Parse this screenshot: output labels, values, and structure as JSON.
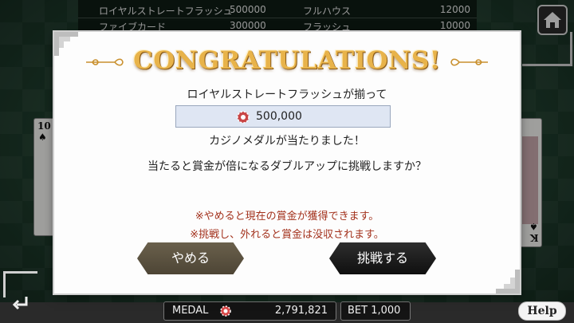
{
  "paytable": [
    {
      "name1": "ロイヤルストレートフラッシュ",
      "value1": "500000",
      "name2": "フルハウス",
      "value2": "12000"
    },
    {
      "name1": "ファイブカード",
      "value1": "300000",
      "name2": "フラッシュ",
      "value2": "10000"
    }
  ],
  "cards": {
    "left_rank": "10",
    "left_suit": "♠",
    "right_rank": "K",
    "right_suit": "♠"
  },
  "dialog": {
    "title": "CONGRATULATIONS!",
    "line1": "ロイヤルストレートフラッシュが揃って",
    "amount": "500,000",
    "line2": "カジノメダルが当たりました！",
    "line3": "当たると賞金が倍になるダブルアップに挑戦しますか？",
    "note1": "※やめると現在の賞金が獲得できます。",
    "note2": "※挑戦し、外れると賞金は没収されます。",
    "quit_label": "やめる",
    "challenge_label": "挑戦する"
  },
  "status": {
    "medal_label": "MEDAL",
    "medal_value": "2,791,821",
    "bet_label": "BET 1,000",
    "help_label": "Help"
  },
  "icons": {
    "home": "home-icon",
    "back": "back-arrow-icon",
    "chip": "chip-icon"
  },
  "colors": {
    "title_gold": "#e8b34a",
    "note_red": "#a3311c",
    "amount_bg": "#dfe6f3"
  }
}
